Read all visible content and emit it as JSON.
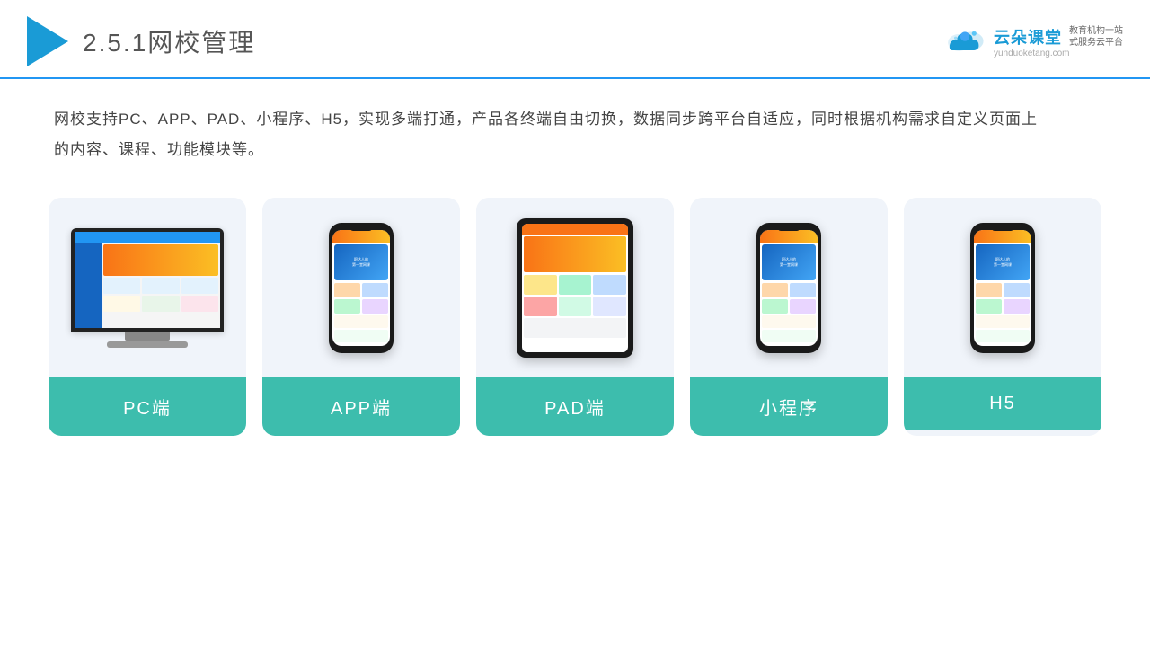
{
  "header": {
    "title_prefix": "2.5.1",
    "title_main": "网校管理",
    "brand_name": "云朵课堂",
    "brand_url": "yunduoketang.com",
    "brand_tagline_line1": "教育机构一站",
    "brand_tagline_line2": "式服务云平台"
  },
  "description": {
    "text": "网校支持PC、APP、PAD、小程序、H5，实现多端打通，产品各终端自由切换，数据同步跨平台自适应，同时根据机构需求自定义页面上的内容、课程、功能模块等。"
  },
  "cards": [
    {
      "id": "pc",
      "label": "PC端",
      "type": "pc"
    },
    {
      "id": "app",
      "label": "APP端",
      "type": "phone"
    },
    {
      "id": "pad",
      "label": "PAD端",
      "type": "tablet"
    },
    {
      "id": "mini",
      "label": "小程序",
      "type": "phone"
    },
    {
      "id": "h5",
      "label": "H5",
      "type": "phone"
    }
  ],
  "colors": {
    "accent": "#3DBDAD",
    "header_line": "#2196F3",
    "card_bg": "#f0f4fa"
  }
}
